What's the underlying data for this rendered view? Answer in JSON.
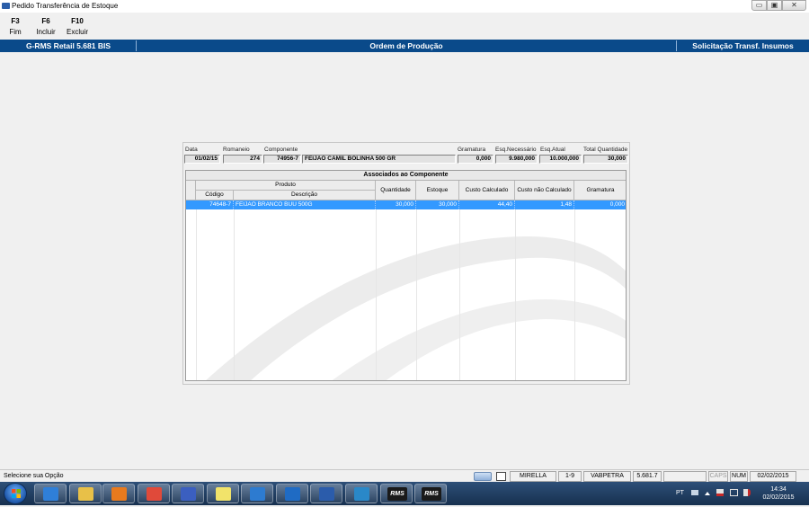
{
  "window": {
    "title": "Pedido Transferência de Estoque",
    "controls": {
      "minimize": "▭",
      "maximize": "▣",
      "close": "✕"
    }
  },
  "toolbar": [
    {
      "key": "F3",
      "label": "Fim"
    },
    {
      "key": "F6",
      "label": "Incluir"
    },
    {
      "key": "F10",
      "label": "Excluir"
    }
  ],
  "band": {
    "left": "G-RMS Retail 5.681 BIS",
    "center": "Ordem de Produção",
    "right": "Solicitação Transf. Insumos"
  },
  "header": {
    "labels": {
      "data": "Data",
      "romaneio": "Romaneio",
      "componente": "Componente",
      "gramatura": "Gramatura",
      "esq_necessario": "Esq.Necessário",
      "esq_atual": "Esq.Atual",
      "total_quantidade": "Total Quantidade"
    },
    "values": {
      "data": "01/02/15",
      "romaneio": "274",
      "componente_codigo": "74956-7",
      "componente_descricao": "FEIJAO CAMIL BOLINHA 500 GR",
      "gramatura": "0,000",
      "esq_necessario": "9.980,000",
      "esq_atual": "10.000,000",
      "total_quantidade": "30,000"
    }
  },
  "grid": {
    "caption": "Associados ao Componente",
    "group_produto": "Produto",
    "columns": {
      "codigo": "Código",
      "descricao": "Descrição",
      "quantidade": "Quantidade",
      "estoque": "Estoque",
      "custo_calculado": "Custo Calculado",
      "custo_nao_calculado": "Custo não Calculado",
      "gramatura": "Gramatura"
    },
    "rows": [
      {
        "codigo": "74648-7",
        "descricao": "FEIJAO BRANCO BUU 500G",
        "quantidade": "30,000",
        "estoque": "30,000",
        "custo_calculado": "44,40",
        "custo_nao_calculado": "1,48",
        "gramatura": "0,000"
      }
    ]
  },
  "statusbar": {
    "message": "Selecione sua Opção",
    "user": "MIRELLA",
    "range": "1-9",
    "host": "VABPETRA",
    "version": "5.681.7",
    "caps": "CAPS",
    "num": "NUM",
    "date": "02/02/2015"
  },
  "taskbar": {
    "apps": [
      {
        "icon": "ie-icon",
        "color": "#2f7fd8"
      },
      {
        "icon": "explorer-icon",
        "color": "#e8c048"
      },
      {
        "icon": "media-player-icon",
        "color": "#e87a1e"
      },
      {
        "icon": "chrome-icon",
        "color": "#e04a3a"
      },
      {
        "icon": "network-app-icon",
        "color": "#3b5fc0"
      },
      {
        "icon": "sticky-notes-icon",
        "color": "#f1e36a"
      },
      {
        "icon": "lync-icon",
        "color": "#2d7bd0"
      },
      {
        "icon": "outlook-icon",
        "color": "#1f6bc4"
      },
      {
        "icon": "word-icon",
        "color": "#2b5cab"
      },
      {
        "icon": "remote-app-icon",
        "color": "#2a88c8"
      },
      {
        "icon": "rms-app-icon",
        "color": "#1a1a1a",
        "text": "RMS"
      },
      {
        "icon": "rms-app-icon-2",
        "color": "#1a1a1a",
        "text": "RMS"
      }
    ],
    "lang": "PT",
    "time": "14:34",
    "date": "02/02/2015"
  }
}
